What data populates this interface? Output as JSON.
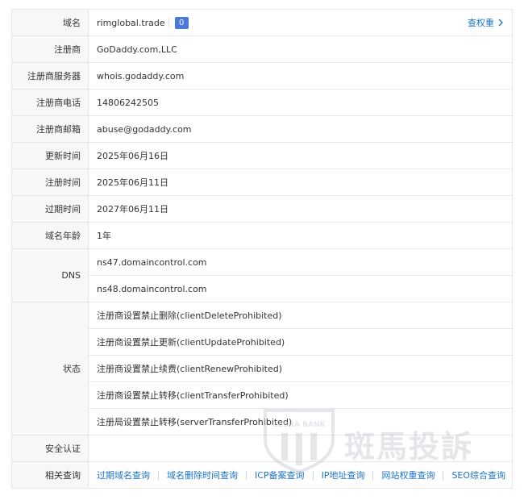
{
  "rows": {
    "domain": {
      "label": "域名",
      "value": "rimglobal.trade",
      "badge": "0",
      "link": "查权重"
    },
    "registrar": {
      "label": "注册商",
      "value": "GoDaddy.com,LLC"
    },
    "registrar_server": {
      "label": "注册商服务器",
      "value": "whois.godaddy.com"
    },
    "registrar_phone": {
      "label": "注册商电话",
      "value": "14806242505"
    },
    "registrar_email": {
      "label": "注册商邮箱",
      "value": "abuse@godaddy.com"
    },
    "updated": {
      "label": "更新时间",
      "value": "2025年06月16日"
    },
    "created": {
      "label": "注册时间",
      "value": "2025年06月11日"
    },
    "expires": {
      "label": "过期时间",
      "value": "2027年06月11日"
    },
    "age": {
      "label": "域名年龄",
      "value": "1年"
    },
    "dns": {
      "label": "DNS",
      "values": [
        "ns47.domaincontrol.com",
        "ns48.domaincontrol.com"
      ]
    },
    "status": {
      "label": "状态",
      "values": [
        "注册商设置禁止删除(clientDeleteProhibited)",
        "注册商设置禁止更新(clientUpdateProhibited)",
        "注册商设置禁止续费(clientRenewProhibited)",
        "注册商设置禁止转移(clientTransferProhibited)",
        "注册局设置禁止转移(serverTransferProhibited)"
      ]
    },
    "security": {
      "label": "安全认证",
      "value": ""
    },
    "related": {
      "label": "相关查询",
      "links": [
        "过期域名查询",
        "域名删除时间查询",
        "ICP备案查询",
        "IP地址查询",
        "网站权重查询",
        "SEO综合查询"
      ]
    }
  },
  "watermark": {
    "brand": "ZEBRA RANK",
    "text": "斑馬投訴"
  },
  "colors": {
    "link": "#1a73c9",
    "badge": "#4a79d9",
    "label_bg": "#f6f7f9",
    "border": "#e6e6e6"
  }
}
